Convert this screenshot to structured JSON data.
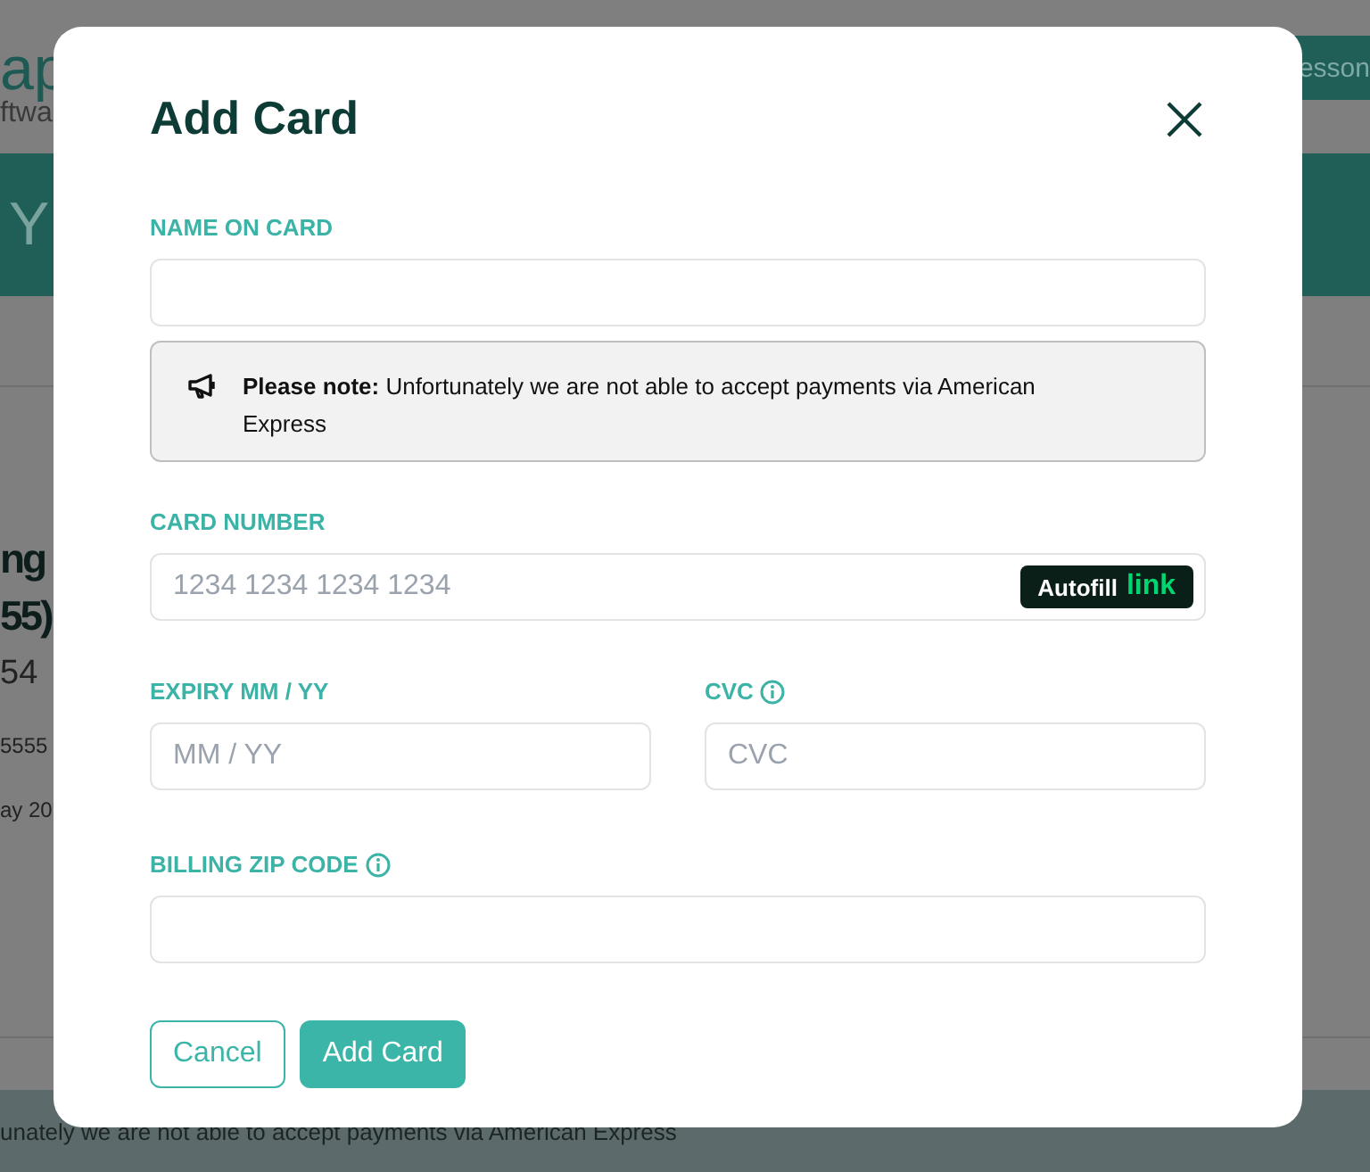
{
  "background": {
    "logo_text": "ap",
    "logo_subtext": "ftwa",
    "header_button": "esson",
    "banner_text": "Y",
    "heading_lines": [
      "ng",
      "55)"
    ],
    "detail_lines": [
      "54",
      "5555",
      "ay 20"
    ],
    "footer_notice": "unately we are not able to accept payments via American Express"
  },
  "dialog": {
    "title": "Add Card",
    "items": [
      {
        "kind": "field",
        "label": "NAME ON CARD",
        "info": false
      },
      {
        "kind": "note",
        "text": "**Please note:** Unfortunately we are not able to accept payments via American Express"
      },
      {
        "kind": "field",
        "label": "CARD NUMBER",
        "info": false,
        "placeholder": "1234 1234 1234 1234",
        "autofill": {
          "text": "Autofill",
          "brand": "link"
        }
      },
      {
        "kind": "pair",
        "fields": [
          {
            "label": "EXPIRY MM / YY",
            "info": false,
            "placeholder": "MM / YY"
          },
          {
            "label": "CVC",
            "info": true,
            "placeholder": "CVC"
          }
        ]
      },
      {
        "kind": "field",
        "label": "BILLING ZIP CODE",
        "info": true
      }
    ],
    "buttons": [
      {
        "label": "Cancel",
        "kind": "secondary"
      },
      {
        "label": "Add Card",
        "kind": "primary"
      }
    ]
  }
}
